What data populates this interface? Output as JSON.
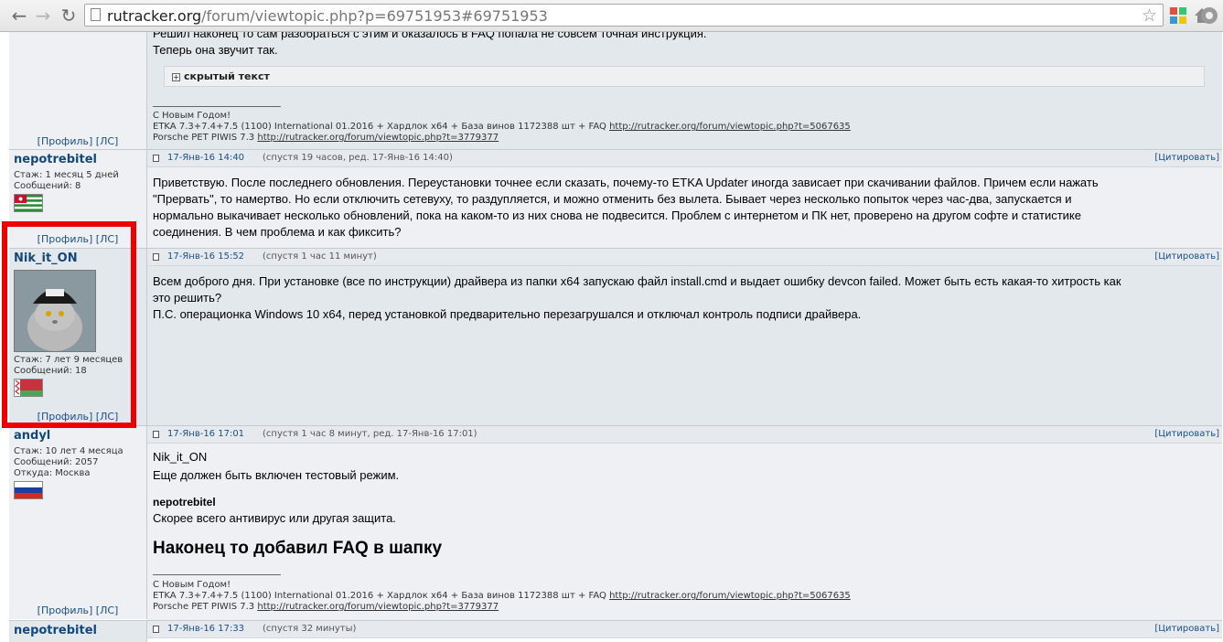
{
  "browser": {
    "back_icon": "back-arrow-icon",
    "forward_icon": "forward-arrow-icon",
    "reload_icon": "reload-icon",
    "url_host": "rutracker.org",
    "url_rest": "/forum/viewtopic.php?p=69751953#69751953"
  },
  "common": {
    "profile_label": "[Профиль]",
    "pm_label": "[ЛС]",
    "quote_label": "[Цитировать]",
    "sig_greeting": "С Новым Годом!",
    "sig_etka": "ETKA 7.3+7.4+7.5 (1100) International 01.2016 + Хардлок x64 + База винов 1172388 шт + FAQ",
    "sig_etka_link": "http://rutracker.org/forum/viewtopic.php?t=5067635",
    "sig_porsche": "Porsche PET PIWIS 7.3",
    "sig_porsche_link": "http://rutracker.org/forum/viewtopic.php?t=3779377"
  },
  "posts": [
    {
      "body_line1": "Решил наконец то сам разобраться с этим и оказалось в FAQ попала не совсем точная инструкция.",
      "body_line2": "Теперь она звучит так.",
      "spoiler_label": "скрытый текст"
    },
    {
      "author": "nepotrebitel",
      "stazh": "Стаж: 1 месяц 5 дней",
      "messages": "Сообщений: 8",
      "date": "17-Янв-16 14:40",
      "info": "(спустя 19 часов, ред. 17-Янв-16 14:40)",
      "body": [
        "Приветствую. После последнего обновления. Переустановки точнее если сказать, почему-то ETKA Updater иногда зависает при скачивании файлов. Причем если нажать",
        "\"Прервать\", то намертво. Но если отключить сетевуху, то раздупляется, и можно отменить без вылета. Бывает через несколько попыток через час-два, запускается и",
        "нормально выкачивает несколько обновлений, пока на каком-то из них снова не подвесится. Проблем с интернетом и ПК нет, проверено на другом софте и статистике",
        "соединения. В чем проблема и как фиксить?"
      ]
    },
    {
      "author": "Nik_it_ON",
      "stazh": "Стаж: 7 лет 9 месяцев",
      "messages": "Сообщений: 18",
      "date": "17-Янв-16 15:52",
      "info": "(спустя 1 час 11 минут)",
      "body": [
        "Всем доброго дня. При установке (все по инструкции) драйвера из папки x64 запускаю файл install.cmd и выдает ошибку devcon failed. Может быть есть какая-то хитрость как",
        "это решить?",
        "П.С. операционка Windows 10 x64, перед установкой предварительно перезагрушался и отключал контроль подписи драйвера."
      ]
    },
    {
      "author": "andyl",
      "stazh": "Стаж: 10 лет 4 месяца",
      "messages": "Сообщений: 2057",
      "from": "Откуда: Москва",
      "date": "17-Янв-16 17:01",
      "info": "(спустя 1 час 8 минут, ред. 17-Янв-16 17:01)",
      "q1_name": "Nik_it_ON",
      "q1_text": "Еще должен быть включен тестовый режим.",
      "q2_name": "nepotrebitel",
      "q2_text": "Скорее всего антивирус или другая защита.",
      "headline": "Наконец то добавил FAQ в шапку"
    },
    {
      "author": "nepotrebitel",
      "date": "17-Янв-16 17:33",
      "info": "(спустя 32 минуты)"
    }
  ],
  "colors": {
    "highlight": "#ee0000",
    "link": "#1a4e8a",
    "nick": "#14477a"
  }
}
